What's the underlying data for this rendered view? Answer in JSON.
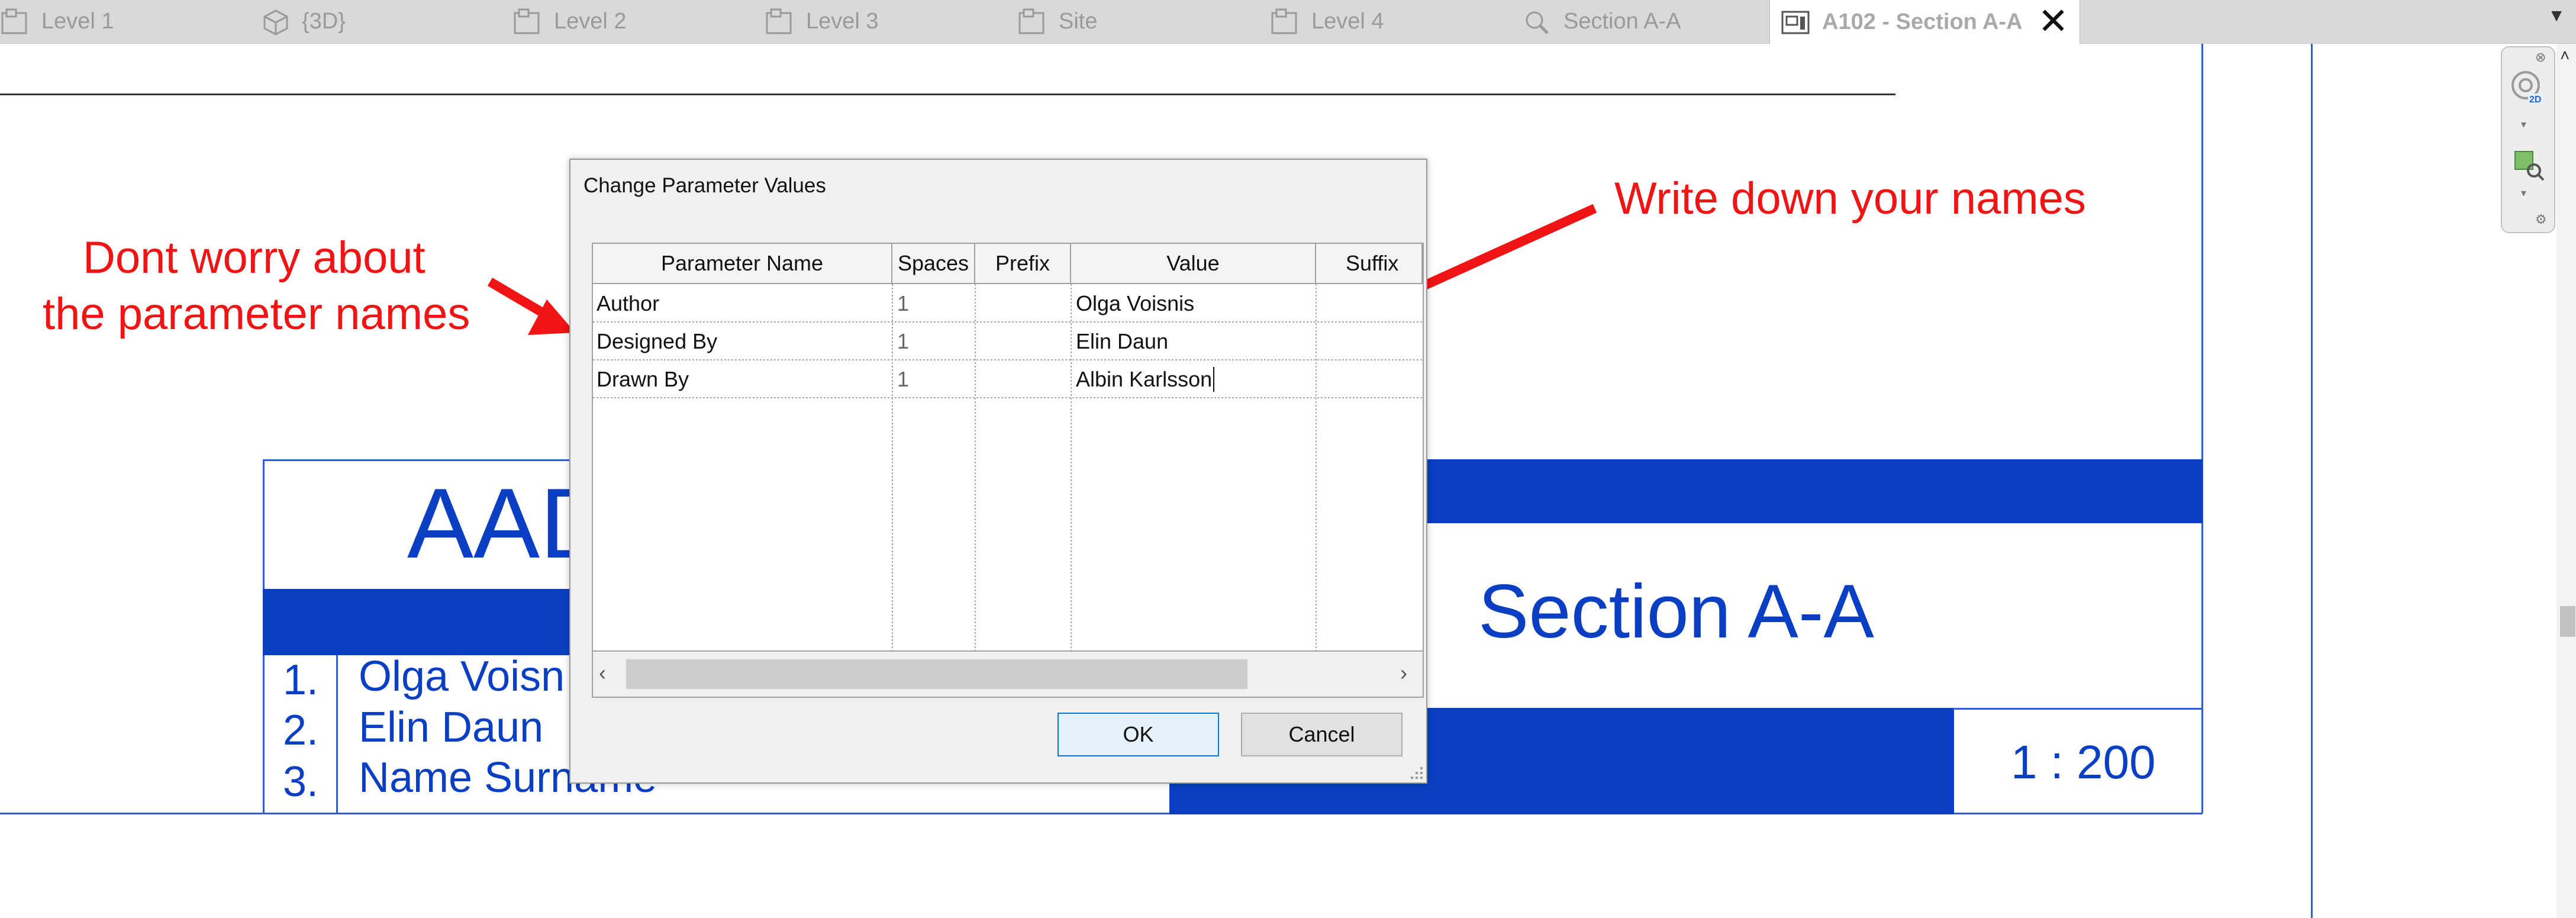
{
  "tabs": [
    {
      "label": "Level 1",
      "icon": "floor-plan-icon"
    },
    {
      "label": "{3D}",
      "icon": "3d-view-icon"
    },
    {
      "label": "Level 2",
      "icon": "floor-plan-icon"
    },
    {
      "label": "Level 3",
      "icon": "floor-plan-icon"
    },
    {
      "label": "Site",
      "icon": "floor-plan-icon"
    },
    {
      "label": "Level 4",
      "icon": "floor-plan-icon"
    },
    {
      "label": "Section A-A",
      "icon": "section-icon"
    },
    {
      "label": "A102 - Section A-A",
      "icon": "sheet-icon",
      "active": true
    }
  ],
  "sheet": {
    "project_title_partial": "AAD",
    "view_title": "Section A-A",
    "scale": "1 : 200",
    "names": [
      {
        "num": "1.",
        "name": "Olga Voisn"
      },
      {
        "num": "2.",
        "name": "Elin Daun"
      },
      {
        "num": "3.",
        "name": "Name Surname"
      }
    ],
    "colors": {
      "title_block_blue": "#0a3fc4"
    }
  },
  "annotations": {
    "left_line1": "Dont worry about",
    "left_line2": "the parameter names",
    "right": "Write down your names",
    "color": "#f01414"
  },
  "dialog": {
    "title": "Change Parameter Values",
    "columns": [
      "Parameter Name",
      "Spaces",
      "Prefix",
      "Value",
      "Suffix"
    ],
    "rows": [
      {
        "name": "Author",
        "spaces": "1",
        "prefix": "",
        "value": "Olga Voisnis",
        "suffix": ""
      },
      {
        "name": "Designed By",
        "spaces": "1",
        "prefix": "",
        "value": "Elin Daun",
        "suffix": ""
      },
      {
        "name": "Drawn By",
        "spaces": "1",
        "prefix": "",
        "value": "Albin Karlsson",
        "suffix": ""
      }
    ],
    "ok_label": "OK",
    "cancel_label": "Cancel"
  }
}
